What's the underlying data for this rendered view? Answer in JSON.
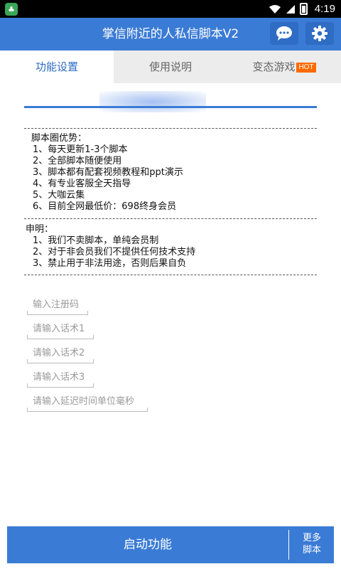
{
  "status_bar": {
    "time": "4:19"
  },
  "header": {
    "title": "掌信附近的人私信脚本V2"
  },
  "tabs": [
    {
      "label": "功能设置",
      "active": true
    },
    {
      "label": "使用说明",
      "active": false
    },
    {
      "label": "变态游戏",
      "badge": "HOT",
      "active": false
    }
  ],
  "advantages": {
    "heading": "脚本圈优势：",
    "items": [
      "1、每天更新1-3个脚本",
      "2、全部脚本随便使用",
      "3、脚本都有配套视频教程和ppt演示",
      "4、有专业客服全天指导",
      "5、大咖云集",
      "6、目前全网最低价：698终身会员"
    ]
  },
  "statement": {
    "heading": "申明：",
    "items": [
      "1、我们不卖脚本，单纯会员制",
      "2、对于非会员我们不提供任何技术支持",
      "3、禁止用于非法用途，否则后果自负"
    ]
  },
  "inputs": [
    {
      "placeholder": "输入注册码",
      "value": ""
    },
    {
      "placeholder": "请输入话术1",
      "value": ""
    },
    {
      "placeholder": "请输入话术2",
      "value": ""
    },
    {
      "placeholder": "请输入话术3",
      "value": ""
    },
    {
      "placeholder": "请输入延迟时间单位毫秒",
      "value": ""
    }
  ],
  "footer": {
    "start_label": "启动功能",
    "more_label_1": "更多",
    "more_label_2": "脚本"
  },
  "colors": {
    "primary": "#3a7bd5",
    "hot_badge": "#ff6a00",
    "status_bar": "#000000"
  }
}
